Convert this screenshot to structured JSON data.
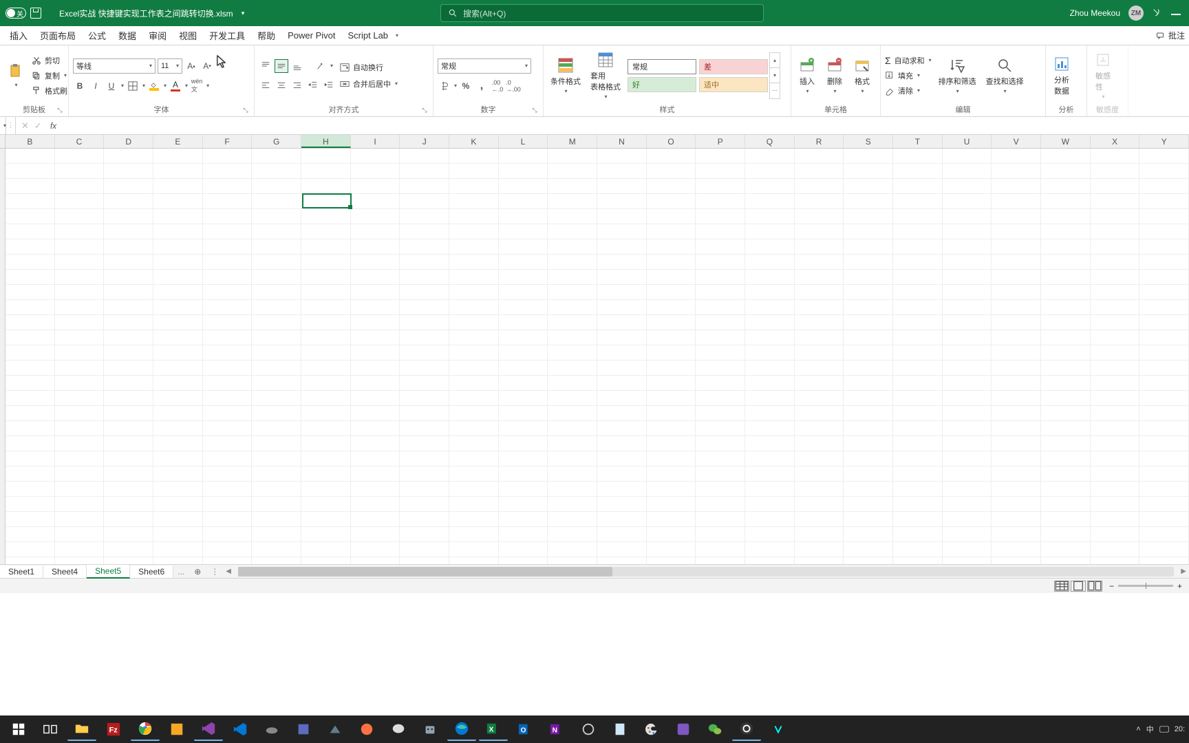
{
  "title": "Excel实战 快捷键实现工作表之间跳转切换.xlsm",
  "toggle_label": "关",
  "search_placeholder": "搜索(Alt+Q)",
  "user_name": "Zhou Meekou",
  "user_initials": "ZM",
  "ribbon_tabs": [
    "插入",
    "页面布局",
    "公式",
    "数据",
    "审阅",
    "视图",
    "开发工具",
    "帮助",
    "Power Pivot",
    "Script Lab"
  ],
  "ribbon_right": "批注",
  "clipboard": {
    "cut": "剪切",
    "copy": "复制",
    "painter": "格式刷",
    "label": "剪贴板"
  },
  "font": {
    "name": "等线",
    "size": "11",
    "label": "字体"
  },
  "alignment": {
    "wrap": "自动换行",
    "merge": "合并后居中",
    "label": "对齐方式"
  },
  "number": {
    "format": "常规",
    "label": "数字"
  },
  "styles": {
    "cond": "条件格式",
    "table": "套用\n表格格式",
    "normal": "常规",
    "bad": "差",
    "good": "好",
    "neutral": "适中",
    "label": "样式"
  },
  "cells": {
    "insert": "插入",
    "delete": "删除",
    "format": "格式",
    "label": "单元格"
  },
  "editing": {
    "sum": "自动求和",
    "fill": "填充",
    "clear": "清除",
    "sort": "排序和筛选",
    "find": "查找和选择",
    "label": "编辑"
  },
  "analysis": {
    "analyze": "分析\n数据",
    "label": "分析"
  },
  "sensitivity": {
    "btn": "敏感\n性",
    "label": "敏感度"
  },
  "columns": [
    "B",
    "C",
    "D",
    "E",
    "F",
    "G",
    "H",
    "I",
    "J",
    "K",
    "L",
    "M",
    "N",
    "O",
    "P",
    "Q",
    "R",
    "S",
    "T",
    "U",
    "V",
    "W",
    "X",
    "Y"
  ],
  "selected_col_index": 6,
  "selected_row_index": 3,
  "sheets": [
    "Sheet1",
    "Sheet4",
    "Sheet5",
    "Sheet6"
  ],
  "active_sheet": 2,
  "sheet_more": "...",
  "tray": {
    "ime": "中",
    "time": "20:"
  }
}
